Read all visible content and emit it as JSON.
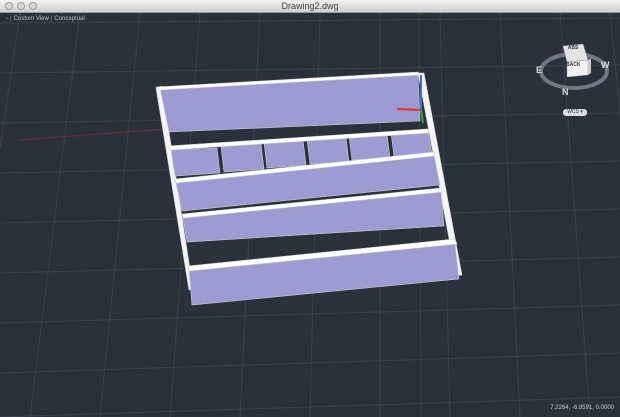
{
  "window": {
    "title": "Drawing2.dwg"
  },
  "viewport": {
    "controls": {
      "minus": "-",
      "view": "Custom View",
      "style": "Conceptual"
    },
    "background": "#2a313b",
    "grid_color": "#3a4350",
    "panel_color": "#9e9ad2",
    "edge_color": "#f2f2f2"
  },
  "viewcube": {
    "top": "ABS",
    "front": "BACK",
    "north": "N",
    "east": "E",
    "west": "W",
    "wcs": "WCS ▾"
  },
  "status": {
    "coordinates": "7.2264, -6.8591, 0.0000"
  }
}
